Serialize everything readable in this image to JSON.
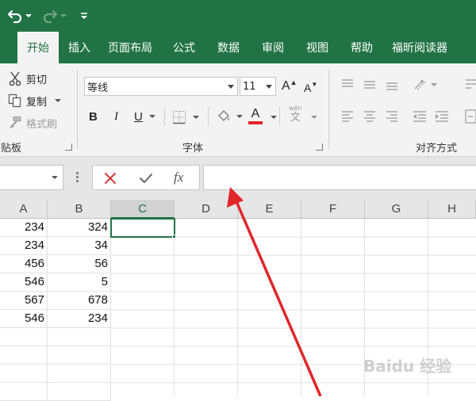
{
  "colors": {
    "excel_green": "#217346",
    "ribbon_bg": "#f3f3f3",
    "arrow_red": "#e0262a",
    "font_color_bar": "#e0262a"
  },
  "quick_access": {
    "undo_icon": "undo-icon",
    "redo_icon": "redo-icon",
    "customize_icon": "customize-qat-icon"
  },
  "tabs": [
    {
      "label": "开始",
      "active": true
    },
    {
      "label": "插入",
      "active": false
    },
    {
      "label": "页面布局",
      "active": false
    },
    {
      "label": "公式",
      "active": false
    },
    {
      "label": "数据",
      "active": false
    },
    {
      "label": "审阅",
      "active": false
    },
    {
      "label": "视图",
      "active": false
    },
    {
      "label": "帮助",
      "active": false
    },
    {
      "label": "福昕阅读器",
      "active": false
    }
  ],
  "ribbon": {
    "clipboard": {
      "cut_label": "剪切",
      "copy_label": "复制",
      "format_painter_label": "格式刷",
      "group_label": "剪贴板"
    },
    "font": {
      "font_name": "等线",
      "font_size": "11",
      "bold_label": "B",
      "italic_label": "I",
      "underline_label": "U",
      "font_color_label": "A",
      "increase_size_label": "A",
      "decrease_size_label": "A",
      "phonetic_label": "文",
      "phonetic_small": "wén",
      "group_label": "字体"
    },
    "alignment": {
      "group_label": "对齐方式"
    }
  },
  "formula_bar": {
    "name_box_value": "",
    "cancel_icon": "cancel-icon",
    "enter_icon": "check-icon",
    "fx_label": "fx",
    "formula_value": ""
  },
  "sheet": {
    "columns": [
      "A",
      "B",
      "C",
      "D",
      "E",
      "F",
      "G",
      "H"
    ],
    "selected_column": "C",
    "rows": [
      [
        "234",
        "324"
      ],
      [
        "234",
        "34"
      ],
      [
        "456",
        "56"
      ],
      [
        "546",
        "5"
      ],
      [
        "567",
        "678"
      ],
      [
        "546",
        "234"
      ],
      [
        "",
        ""
      ],
      [
        "",
        ""
      ],
      [
        "",
        ""
      ],
      [
        "",
        ""
      ]
    ],
    "active_cell": "C1"
  },
  "annotation": {
    "type": "red-arrow",
    "points_to": "formula-input"
  },
  "watermark": {
    "text": "Baidu 经验"
  }
}
